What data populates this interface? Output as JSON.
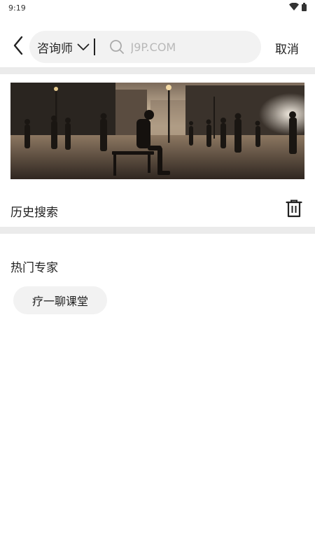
{
  "status_bar": {
    "time": "9:19",
    "icons": [
      "wifi-icon",
      "battery-icon"
    ]
  },
  "search_header": {
    "back_icon": "chevron-left-icon",
    "category": "咨询师",
    "category_icon": "chevron-down-icon",
    "search_icon": "search-icon",
    "search_placeholder": "J9P.COM",
    "search_value": "",
    "cancel_label": "取消"
  },
  "banner": {
    "image_subject": "man sitting on bench in a busy plaza at sunset"
  },
  "history": {
    "title": "历史搜索",
    "clear_icon": "trash-icon"
  },
  "hot_experts": {
    "title": "热门专家",
    "tags": [
      "疗一聊课堂"
    ]
  },
  "colors": {
    "background": "#ffffff",
    "pill": "#f2f2f2",
    "separator": "#ebebeb",
    "text": "#222222",
    "placeholder": "#b8b8b8"
  }
}
